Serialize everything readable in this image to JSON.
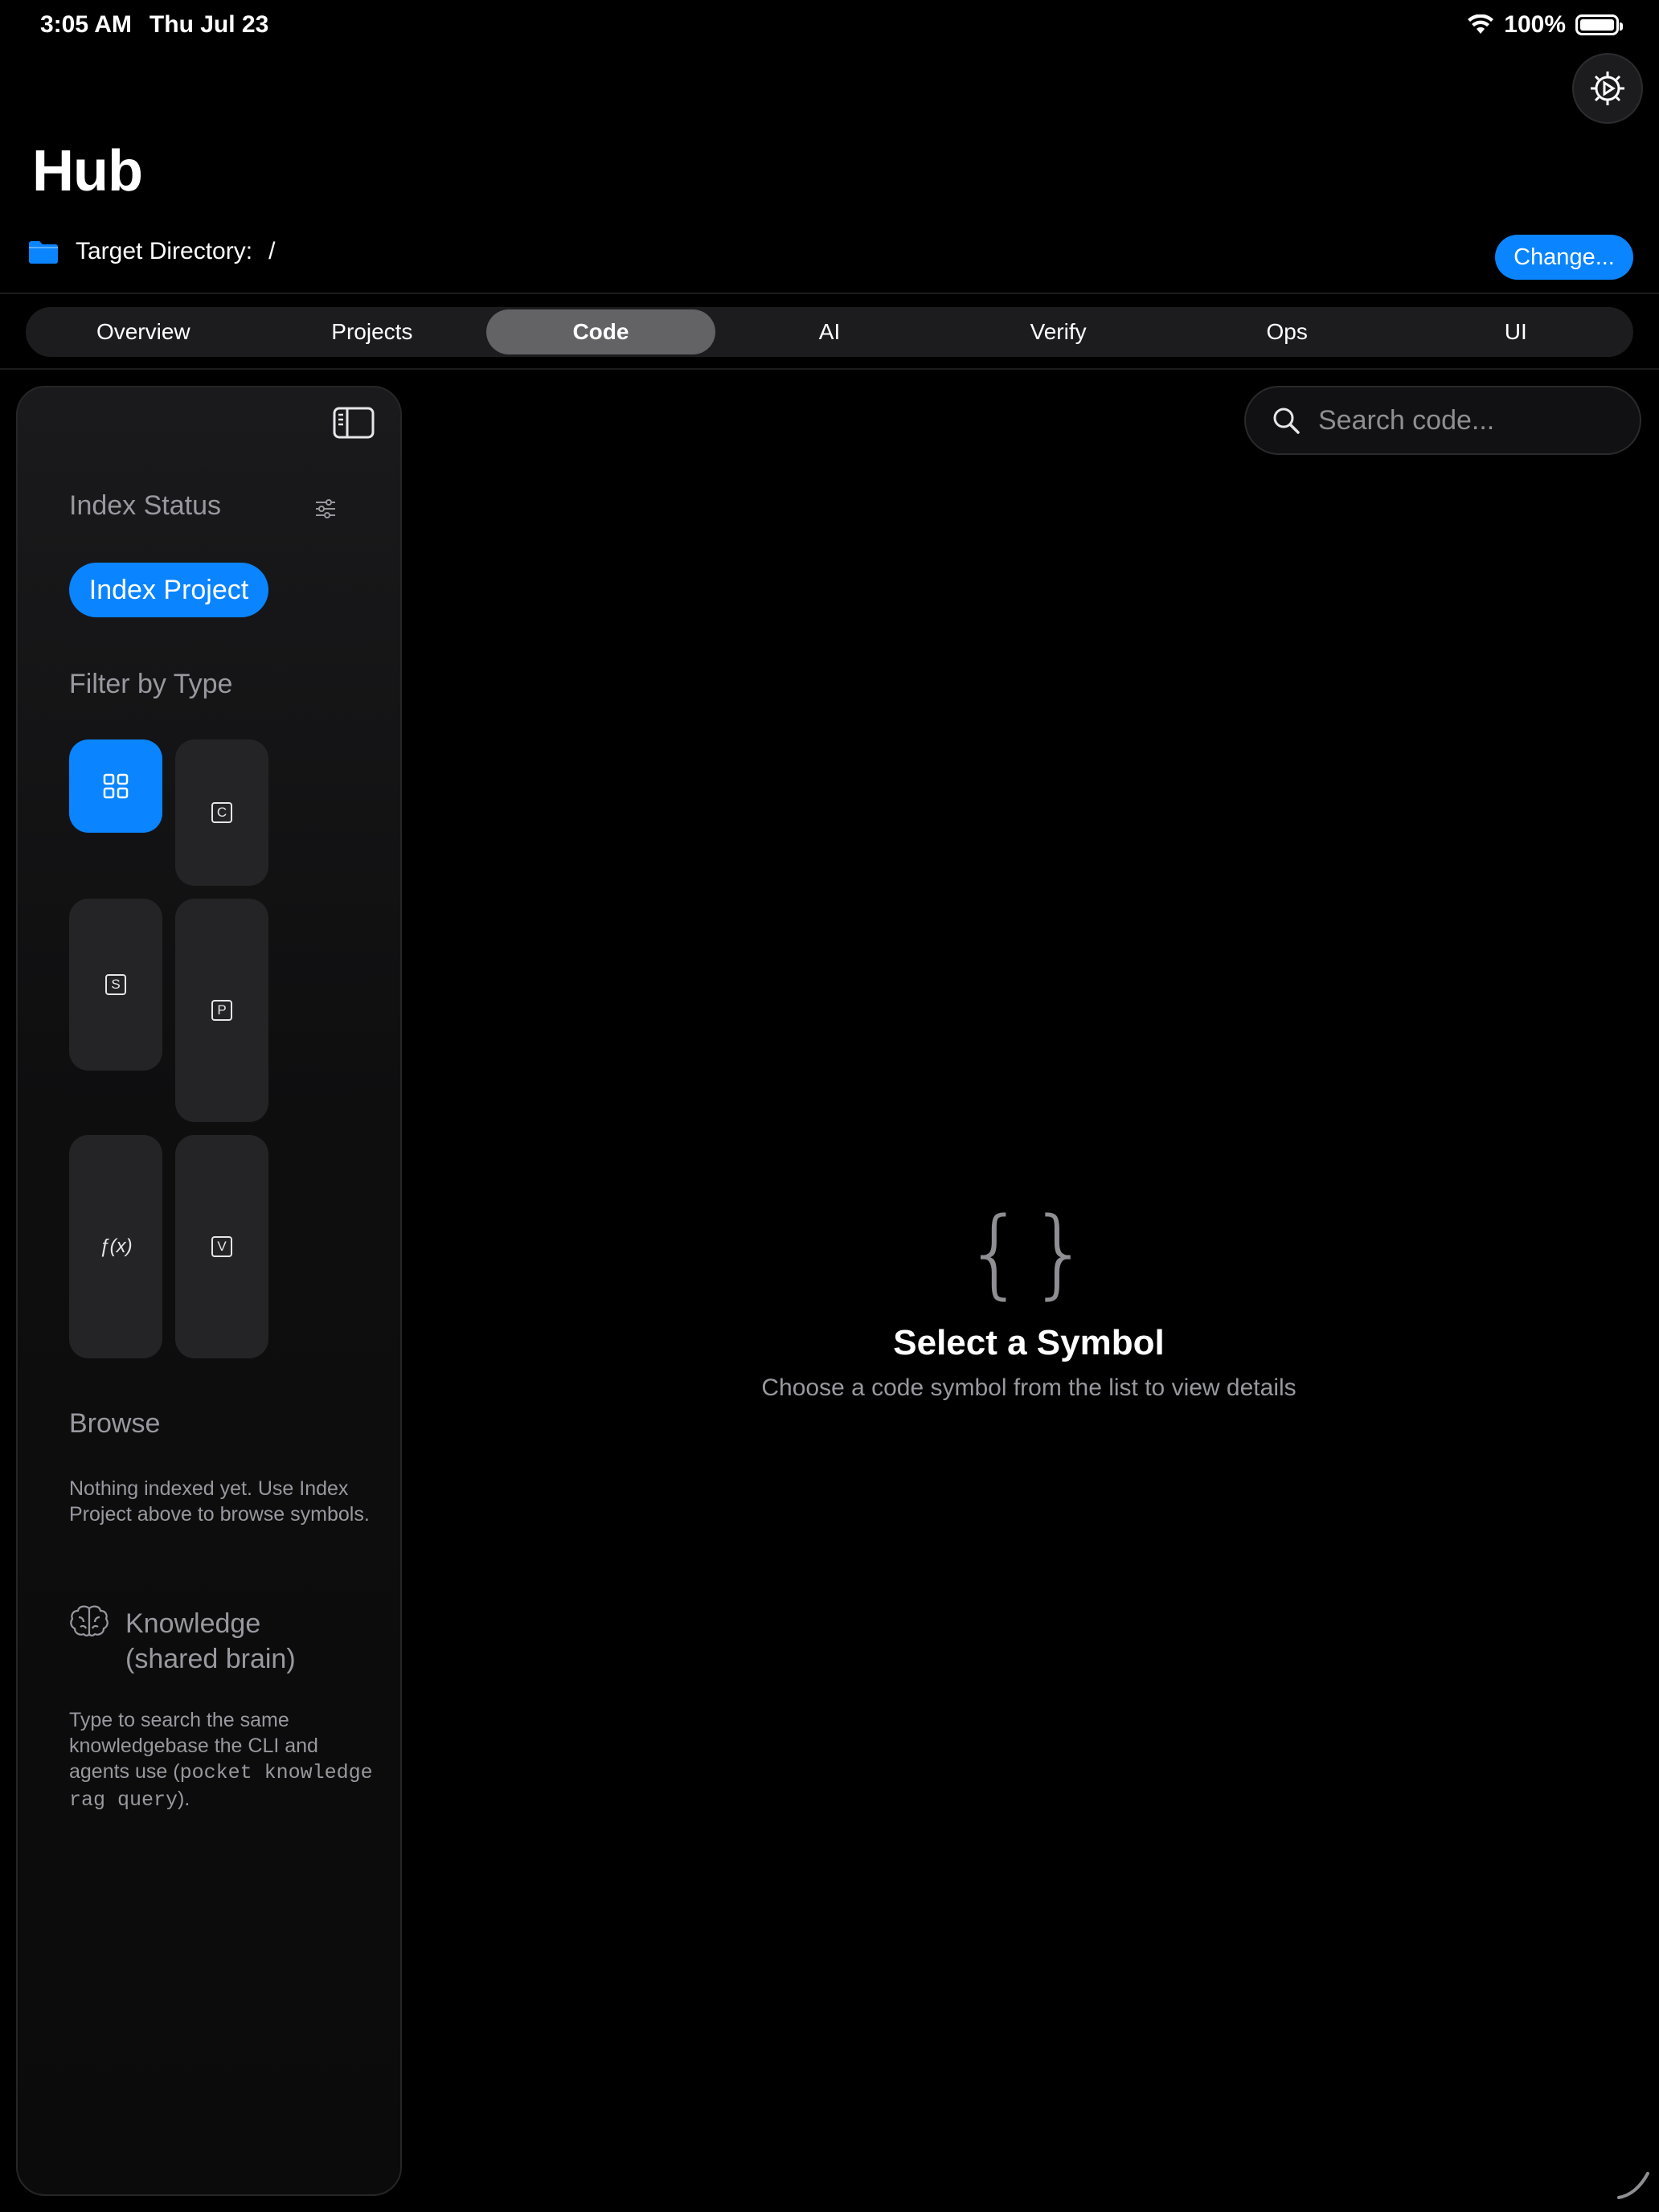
{
  "status_bar": {
    "time": "3:05 AM",
    "date": "Thu Jul 23",
    "battery": "100%"
  },
  "header": {
    "title": "Hub",
    "target_directory_label": "Target Directory:",
    "target_directory_value": "/",
    "change_button": "Change..."
  },
  "tabs": [
    {
      "label": "Overview",
      "active": false
    },
    {
      "label": "Projects",
      "active": false
    },
    {
      "label": "Code",
      "active": true
    },
    {
      "label": "AI",
      "active": false
    },
    {
      "label": "Verify",
      "active": false
    },
    {
      "label": "Ops",
      "active": false
    },
    {
      "label": "UI",
      "active": false
    }
  ],
  "sidebar": {
    "index_status_title": "Index Status",
    "index_project_button": "Index Project",
    "filter_title": "Filter by Type",
    "filters": [
      {
        "name": "all",
        "icon": "grid-icon",
        "selected": true
      },
      {
        "name": "class",
        "letter": "C"
      },
      {
        "name": "struct",
        "letter": "S"
      },
      {
        "name": "protocol",
        "letter": "P"
      },
      {
        "name": "function",
        "label": "ƒ(x)"
      },
      {
        "name": "variable",
        "letter": "V"
      }
    ],
    "browse_title": "Browse",
    "browse_empty": "Nothing indexed yet. Use Index Project above to browse symbols.",
    "knowledge_title_line1": "Knowledge",
    "knowledge_title_line2": "(shared brain)",
    "knowledge_text_pre": "Type to search the same knowledgebase the CLI and agents use (",
    "knowledge_text_code": "pocket knowledge rag query",
    "knowledge_text_post": ")."
  },
  "search": {
    "placeholder": "Search code..."
  },
  "empty_state": {
    "icon": "{}",
    "title": "Select a Symbol",
    "subtitle": "Choose a code symbol from the list to view details"
  },
  "colors": {
    "accent": "#0a84ff",
    "background": "#000000",
    "secondary_text": "#98989f"
  }
}
